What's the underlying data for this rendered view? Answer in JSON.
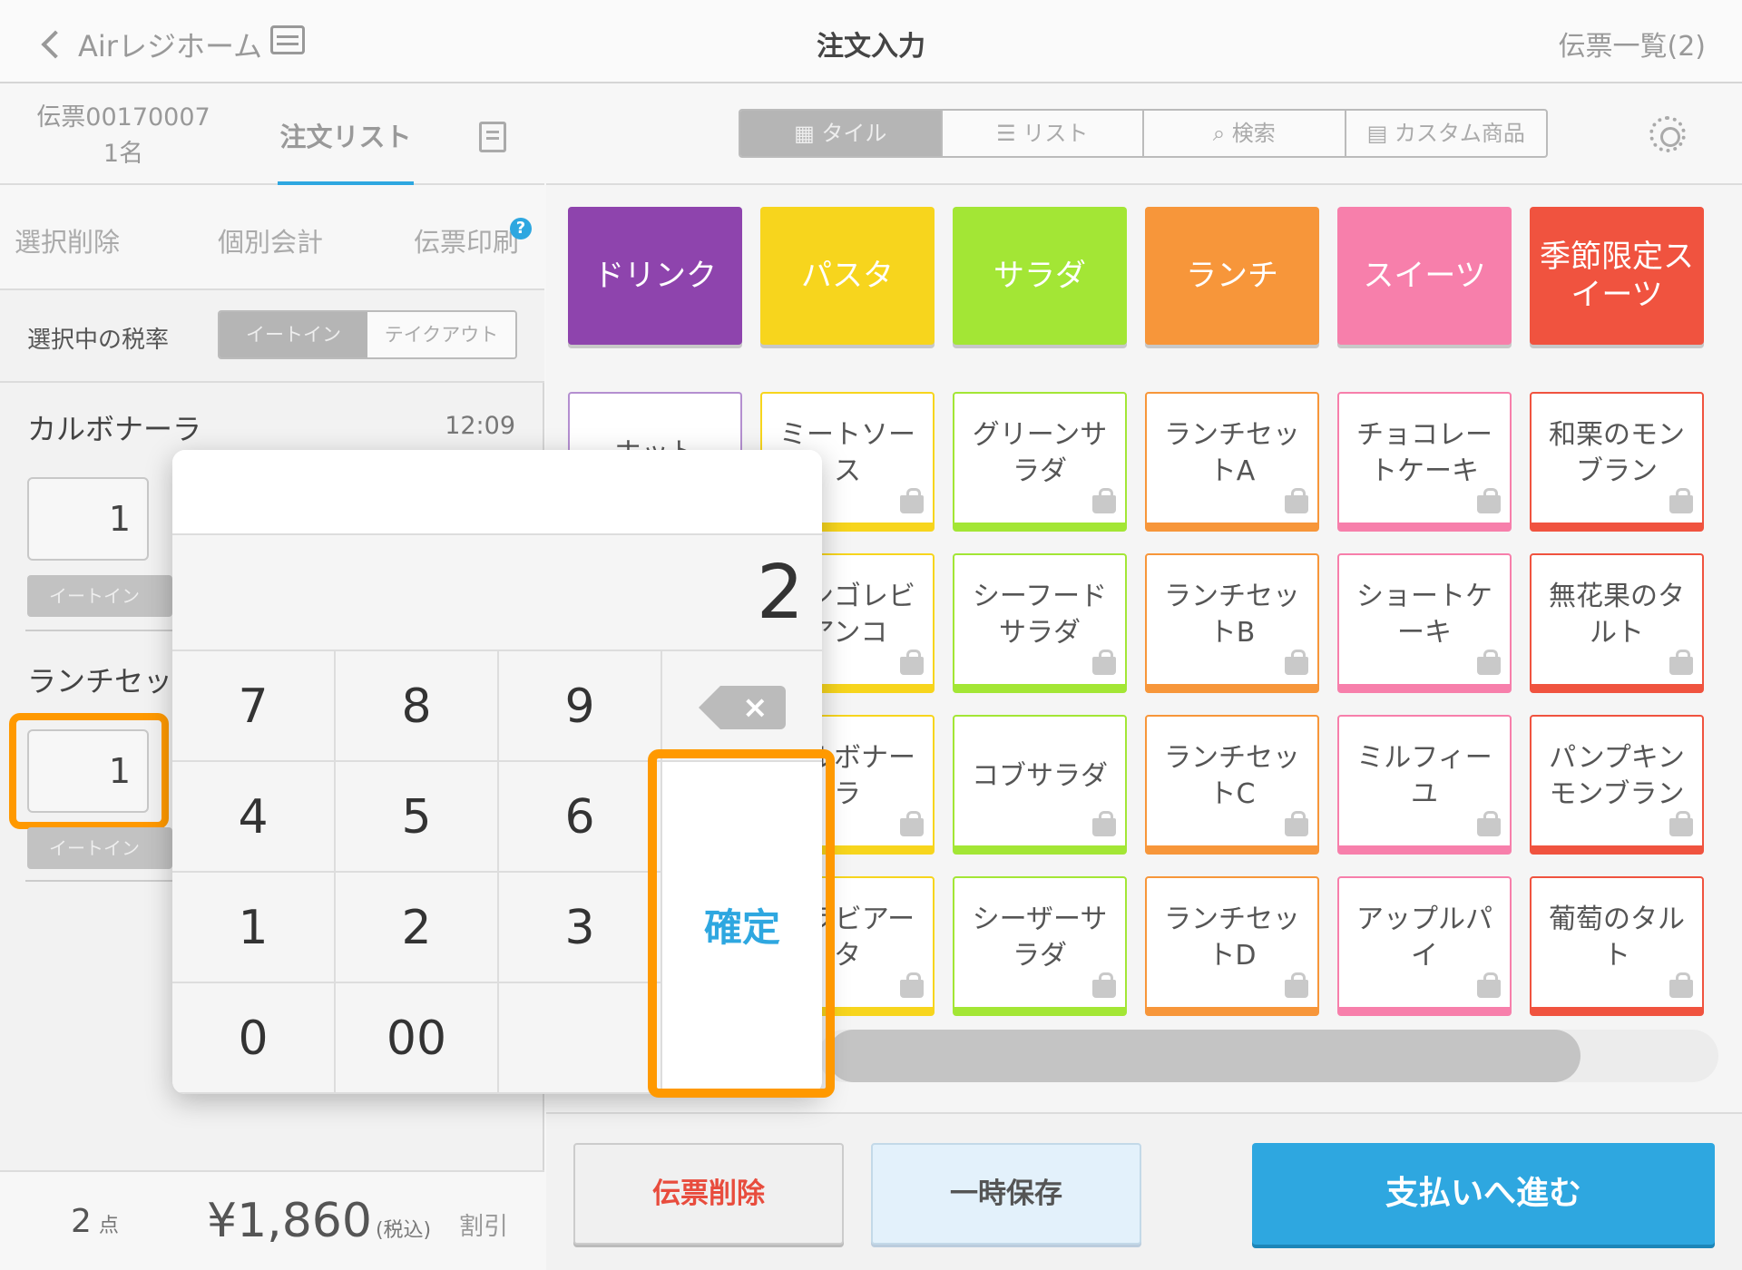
{
  "header": {
    "back_label": "Airレジホーム",
    "title": "注文入力",
    "slip_list": "伝票一覧(2)"
  },
  "slip": {
    "number": "伝票00170007",
    "guests": "1名",
    "order_tab": "注文リスト"
  },
  "actions": {
    "delete_selected": "選択削除",
    "split_bill": "個別会計",
    "print_slip": "伝票印刷",
    "help": "?"
  },
  "tax": {
    "label": "選択中の税率",
    "eat_in": "イートイン",
    "take_out": "テイクアウト"
  },
  "order_items": [
    {
      "name": "カルボナーラ",
      "time": "12:09",
      "qty": "1",
      "tax": "イートイン"
    },
    {
      "name": "ランチセットA",
      "time": "",
      "qty": "1",
      "tax": "イートイン"
    }
  ],
  "summary": {
    "count": "2",
    "count_unit": "点",
    "total": "¥1,860",
    "tax_note": "(税込)",
    "discount": "割引"
  },
  "view_modes": [
    "タイル",
    "リスト",
    "検索",
    "カスタム商品"
  ],
  "categories": [
    {
      "label": "ドリンク",
      "color": "#8e44ad"
    },
    {
      "label": "パスタ",
      "color": "#f7d51d"
    },
    {
      "label": "サラダ",
      "color": "#a3e635"
    },
    {
      "label": "ランチ",
      "color": "#f7963a"
    },
    {
      "label": "スイーツ",
      "color": "#f77fab"
    },
    {
      "label": "季節限定スイーツ",
      "color": "#f0533f"
    }
  ],
  "products": [
    [
      "ホット",
      "ミートソース",
      "グリーンサラダ",
      "ランチセットA",
      "チョコレートケーキ",
      "和栗のモンブラン"
    ],
    [
      "",
      "ボンゴレビアンコ",
      "シーフードサラダ",
      "ランチセットB",
      "ショートケーキ",
      "無花果のタルト"
    ],
    [
      "",
      "カルボナーラ",
      "コブサラダ",
      "ランチセットC",
      "ミルフィーユ",
      "パンプキンモンブラン"
    ],
    [
      "",
      "アラビアータ",
      "シーザーサラダ",
      "ランチセットD",
      "アップルパイ",
      "葡萄のタルト"
    ]
  ],
  "numpad": {
    "display": "2",
    "keys": [
      "7",
      "8",
      "9",
      "4",
      "5",
      "6",
      "1",
      "2",
      "3",
      "0",
      "00"
    ],
    "confirm": "確定"
  },
  "bottom": {
    "delete_slip": "伝票削除",
    "hold": "一時保存",
    "pay": "支払いへ進む"
  }
}
